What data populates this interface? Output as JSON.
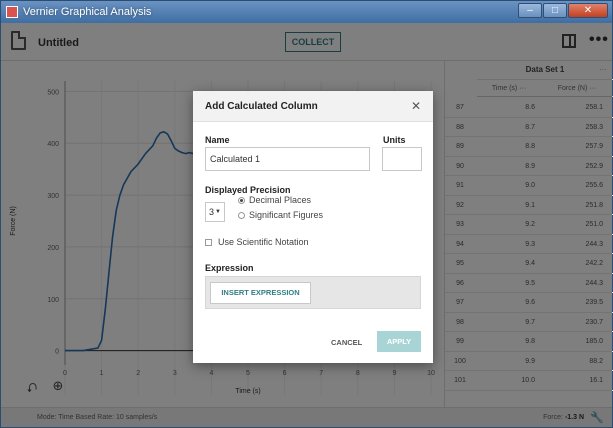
{
  "window": {
    "title": "Vernier Graphical Analysis",
    "buttons": [
      "–",
      "□",
      "✕"
    ]
  },
  "toolbar": {
    "doc_title": "Untitled",
    "collect_label": "COLLECT",
    "more_label": "•••"
  },
  "graph": {
    "y_label": "Force (N)",
    "x_label": "Time (s)",
    "y_ticks": [
      "500",
      "400",
      "300",
      "200",
      "100",
      "0"
    ],
    "x_ticks": [
      "0",
      "1",
      "2",
      "3",
      "4",
      "5",
      "6",
      "7",
      "8",
      "9",
      "10"
    ],
    "tool_icons": [
      "⮏",
      "⊕"
    ]
  },
  "chart_data": {
    "type": "line",
    "xlabel": "Time (s)",
    "ylabel": "Force (N)",
    "xlim": [
      0,
      10
    ],
    "ylim": [
      -20,
      520
    ],
    "x": [
      0,
      0.5,
      0.9,
      1.0,
      1.1,
      1.2,
      1.3,
      1.4,
      1.5,
      1.6,
      1.8,
      2.0,
      2.2,
      2.4,
      2.5,
      2.6,
      2.7,
      2.8,
      2.9,
      3.0,
      3.1,
      3.2,
      3.3,
      3.4,
      3.5
    ],
    "y": [
      0,
      0,
      5,
      20,
      80,
      150,
      220,
      270,
      300,
      320,
      345,
      360,
      380,
      395,
      410,
      420,
      422,
      418,
      405,
      390,
      385,
      382,
      380,
      382,
      380
    ]
  },
  "table": {
    "dataset_title": "Data Set 1",
    "more": "···",
    "col_time": "Time (s)  ···",
    "col_force": "Force (N)  ···",
    "rows": [
      {
        "idx": "87",
        "t": "8.6",
        "f": "258.1"
      },
      {
        "idx": "88",
        "t": "8.7",
        "f": "258.3"
      },
      {
        "idx": "89",
        "t": "8.8",
        "f": "257.9"
      },
      {
        "idx": "90",
        "t": "8.9",
        "f": "252.9"
      },
      {
        "idx": "91",
        "t": "9.0",
        "f": "255.6"
      },
      {
        "idx": "92",
        "t": "9.1",
        "f": "251.8"
      },
      {
        "idx": "93",
        "t": "9.2",
        "f": "251.0"
      },
      {
        "idx": "94",
        "t": "9.3",
        "f": "244.3"
      },
      {
        "idx": "95",
        "t": "9.4",
        "f": "242.2"
      },
      {
        "idx": "96",
        "t": "9.5",
        "f": "244.3"
      },
      {
        "idx": "97",
        "t": "9.6",
        "f": "239.5"
      },
      {
        "idx": "98",
        "t": "9.7",
        "f": "230.7"
      },
      {
        "idx": "99",
        "t": "9.8",
        "f": "185.0"
      },
      {
        "idx": "100",
        "t": "9.9",
        "f": "88.2"
      },
      {
        "idx": "101",
        "t": "10.0",
        "f": "16.1"
      }
    ]
  },
  "status": {
    "mode": "Mode: Time Based   Rate: 10 samples/s",
    "sensor_label": "Force:",
    "sensor_value": "-1.3 N"
  },
  "dialog": {
    "title": "Add Calculated Column",
    "close": "✕",
    "name_label": "Name",
    "name_value": "Calculated 1",
    "units_label": "Units",
    "units_value": "",
    "precision_label": "Displayed Precision",
    "precision_value": "3",
    "radio_decimal": "Decimal Places",
    "radio_sigfig": "Significant Figures",
    "sci_notation": "Use Scientific Notation",
    "expression_label": "Expression",
    "insert_expression": "INSERT EXPRESSION",
    "cancel": "CANCEL",
    "apply": "APPLY"
  }
}
